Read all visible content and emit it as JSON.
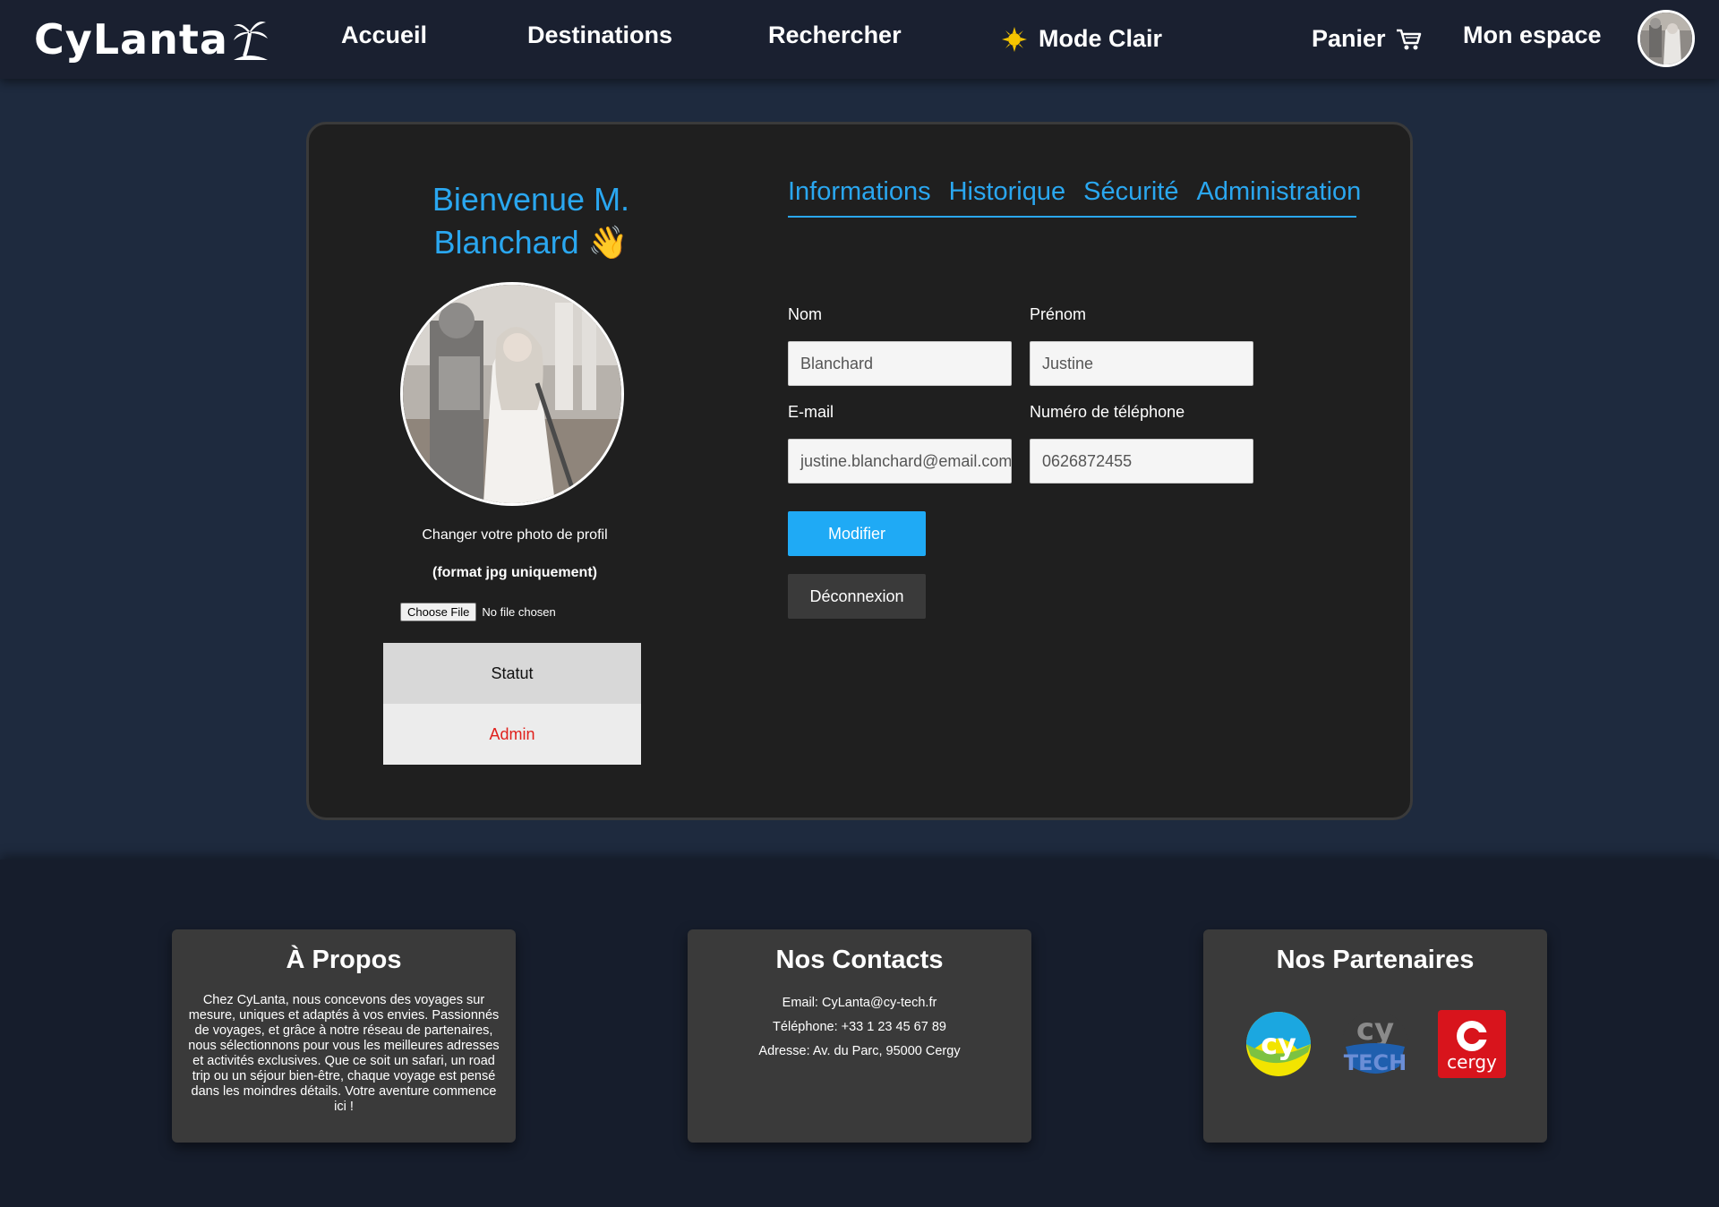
{
  "header": {
    "logo_text": "CyLanta",
    "nav": {
      "accueil": "Accueil",
      "destinations": "Destinations",
      "rechercher": "Rechercher",
      "mode": "Mode Clair",
      "panier": "Panier",
      "espace": "Mon espace"
    }
  },
  "profile": {
    "welcome": "Bienvenue M. Blanchard 👋",
    "photo_label": "Changer votre photo de profil",
    "photo_format": "(format jpg uniquement)",
    "file_button": "Choose File",
    "file_status": "No file chosen",
    "status_header": "Statut",
    "status_value": "Admin",
    "tabs": [
      "Informations",
      "Historique",
      "Sécurité",
      "Administration"
    ],
    "form": {
      "nom_label": "Nom",
      "nom_value": "Blanchard",
      "prenom_label": "Prénom",
      "prenom_value": "Justine",
      "email_label": "E-mail",
      "email_value": "justine.blanchard@email.com",
      "phone_label": "Numéro de téléphone",
      "phone_value": "0626872455"
    },
    "modifier_label": "Modifier",
    "deconnexion_label": "Déconnexion"
  },
  "footer": {
    "about": {
      "title": "À Propos",
      "text": "Chez CyLanta, nous concevons des voyages sur mesure, uniques et adaptés à vos envies. Passionnés de voyages, et grâce à notre réseau de partenaires, nous sélectionnons pour vous les meilleures adresses et activités exclusives. Que ce soit un safari, un road trip ou un séjour bien-être, chaque voyage est pensé dans les moindres détails. Votre aventure commence ici !"
    },
    "contacts": {
      "title": "Nos Contacts",
      "email": "Email: CyLanta@cy-tech.fr",
      "phone": "Téléphone: +33 1 23 45 67 89",
      "address": "Adresse: Av. du Parc, 95000 Cergy"
    },
    "partners": {
      "title": "Nos Partenaires",
      "logos": [
        "cy-logo",
        "cy-tech-logo",
        "cergy-logo"
      ]
    }
  },
  "colors": {
    "accent": "#2aa7f0",
    "admin": "#e0201c",
    "page_bg": "#1e2a3e",
    "card_bg": "#1f1f1f"
  }
}
